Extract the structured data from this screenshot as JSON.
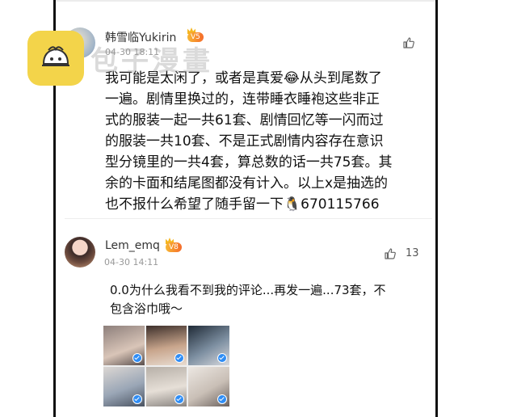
{
  "watermark": {
    "icon": "bun-logo-icon",
    "text": "包子漫畫",
    "accent": "#f3d44a"
  },
  "comments": [
    {
      "username": "韩雪临Yukirin",
      "badge": "V5",
      "timestamp": "04-30 18:11",
      "likes": "",
      "text": "我可能是太闲了，或者是真爱😂从头到尾数了\n一遍。剧情里换过的，连带睡衣睡袍这些非正\n式的服装一起一共61套、剧情回忆等一闪而过\n的服装一共10套、不是正式剧情内容存在意识\n型分镜里的一共4套，算总数的话一共75套。其\n余的卡面和结尾图都没有计入。以上x是抽选的\n也不报什么希望了随手留一下🐧670115766"
    },
    {
      "username": "Lem_emq",
      "badge": "V8",
      "timestamp": "04-30 14:11",
      "likes": "13",
      "text": "0.0为什么我看不到我的评论...再发一遍...73套，不\n包含浴巾哦～"
    }
  ],
  "colors": {
    "badge_gradient_start": "#f7b733",
    "badge_gradient_end": "#f56b2b",
    "check_blue": "#2f8df5",
    "frame": "#111111"
  }
}
